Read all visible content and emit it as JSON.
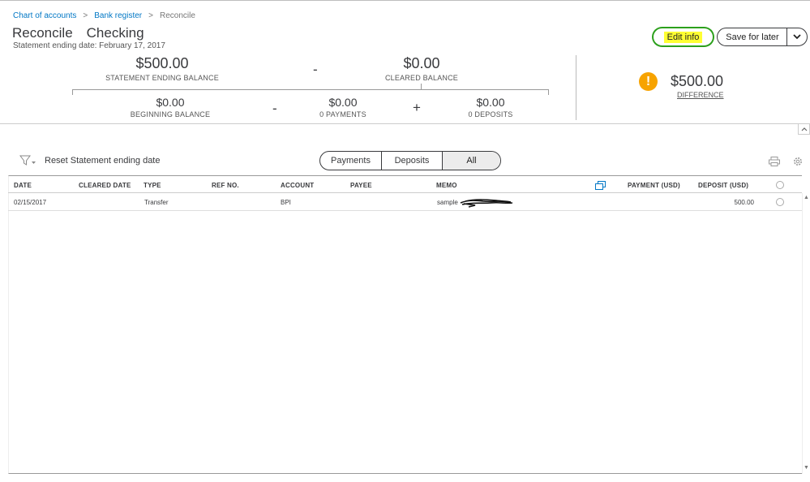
{
  "breadcrumb": {
    "items": [
      "Chart of accounts",
      "Bank register",
      "Reconcile"
    ],
    "separator": ">"
  },
  "header": {
    "title": "Reconcile",
    "account": "Checking",
    "subtitle": "Statement ending date: February 17, 2017"
  },
  "actions": {
    "edit_info": "Edit info",
    "save_for_later": "Save for later"
  },
  "summary": {
    "statement_ending_balance": "$500.00",
    "statement_ending_balance_label": "STATEMENT ENDING BALANCE",
    "minus_op": "-",
    "cleared_balance": "$0.00",
    "cleared_balance_label": "CLEARED BALANCE",
    "beginning_balance": "$0.00",
    "beginning_balance_label": "BEGINNING BALANCE",
    "minus_op2": "-",
    "payments": "$0.00",
    "payments_label": "0 PAYMENTS",
    "plus_op": "+",
    "deposits": "$0.00",
    "deposits_label": "0 DEPOSITS",
    "warning_glyph": "!",
    "difference": "$500.00",
    "difference_label": "DIFFERENCE"
  },
  "toolbar": {
    "reset_label": "Reset Statement ending date",
    "tabs": [
      "Payments",
      "Deposits",
      "All"
    ],
    "selected_tab": "All"
  },
  "table": {
    "columns": [
      "DATE",
      "CLEARED DATE",
      "TYPE",
      "REF NO.",
      "ACCOUNT",
      "PAYEE",
      "MEMO",
      "PAYMENT (USD)",
      "DEPOSIT (USD)"
    ],
    "rows": [
      {
        "date": "02/15/2017",
        "cleared_date": "",
        "type": "Transfer",
        "ref_no": "",
        "account": "BPI",
        "payee": "",
        "memo": "sample",
        "payment": "",
        "deposit": "500.00"
      }
    ]
  },
  "colors": {
    "link": "#0077c5",
    "green": "#2ca01c",
    "highlight": "#ffff33",
    "warning": "#f7a300"
  },
  "icons": [
    "filter-icon",
    "print-icon",
    "gear-icon",
    "copy-icon",
    "chevron-down-icon",
    "warning-icon"
  ]
}
